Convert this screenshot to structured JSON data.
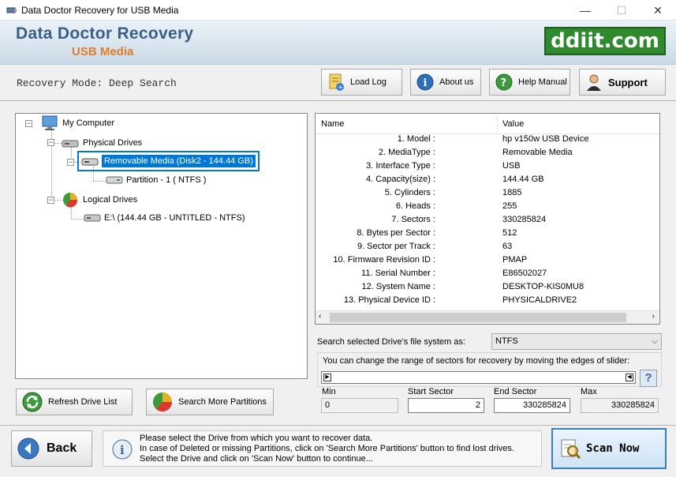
{
  "window": {
    "title": "Data Doctor Recovery for USB Media",
    "minimize": "—",
    "maximize": "☐",
    "close": "✕"
  },
  "header": {
    "title": "Data Doctor Recovery",
    "subtitle": "USB Media",
    "brand": "ddiit.com"
  },
  "mode": "Recovery Mode: Deep Search",
  "toolbar": {
    "load_log": "Load Log",
    "about_us": "About us",
    "help_manual": "Help Manual",
    "support": "Support"
  },
  "tree": {
    "root": "My Computer",
    "physical": "Physical Drives",
    "removable": "Removable Media (Disk2 - 144.44 GB)",
    "partition": "Partition - 1 ( NTFS )",
    "logical": "Logical Drives",
    "logical_drive": "E:\\ (144.44 GB - UNTITLED - NTFS)"
  },
  "table": {
    "col_name": "Name",
    "col_value": "Value",
    "rows": [
      {
        "name": "1. Model :",
        "value": "hp v150w USB Device"
      },
      {
        "name": "2. MediaType :",
        "value": "Removable Media"
      },
      {
        "name": "3. Interface Type :",
        "value": "USB"
      },
      {
        "name": "4. Capacity(size) :",
        "value": "144.44 GB"
      },
      {
        "name": "5. Cylinders :",
        "value": "1885"
      },
      {
        "name": "6. Heads :",
        "value": "255"
      },
      {
        "name": "7. Sectors :",
        "value": "330285824"
      },
      {
        "name": "8. Bytes per Sector :",
        "value": "512"
      },
      {
        "name": "9. Sector per Track :",
        "value": "63"
      },
      {
        "name": "10. Firmware Revision ID :",
        "value": "PMAP"
      },
      {
        "name": "11. Serial Number :",
        "value": "E86502027"
      },
      {
        "name": "12. System Name :",
        "value": "DESKTOP-KIS0MU8"
      },
      {
        "name": "13. Physical Device ID :",
        "value": "PHYSICALDRIVE2"
      }
    ]
  },
  "buttons": {
    "refresh": "Refresh Drive List",
    "search_more": "Search More Partitions",
    "back": "Back",
    "scan_now": "Scan Now"
  },
  "filesystem": {
    "label": "Search selected Drive's file system as:",
    "selected": "NTFS"
  },
  "range": {
    "hint": "You can change the range of sectors for recovery by moving the edges of slider:",
    "help": "?",
    "min_label": "Min",
    "min_value": "0",
    "start_label": "Start Sector",
    "start_value": "2",
    "end_label": "End Sector",
    "end_value": "330285824",
    "max_label": "Max",
    "max_value": "330285824"
  },
  "info": {
    "line1": "Please select the Drive from which you want to recover data.",
    "line2": "In case of Deleted or missing Partitions, click on 'Search More Partitions' button to find lost drives.",
    "line3": "Select the Drive and click on 'Scan Now' button to continue..."
  },
  "colors": {
    "accent": "#3a5f86",
    "subtitle": "#e07b2a",
    "brand_bg": "#2f8a2f",
    "selection": "#0078d7"
  }
}
